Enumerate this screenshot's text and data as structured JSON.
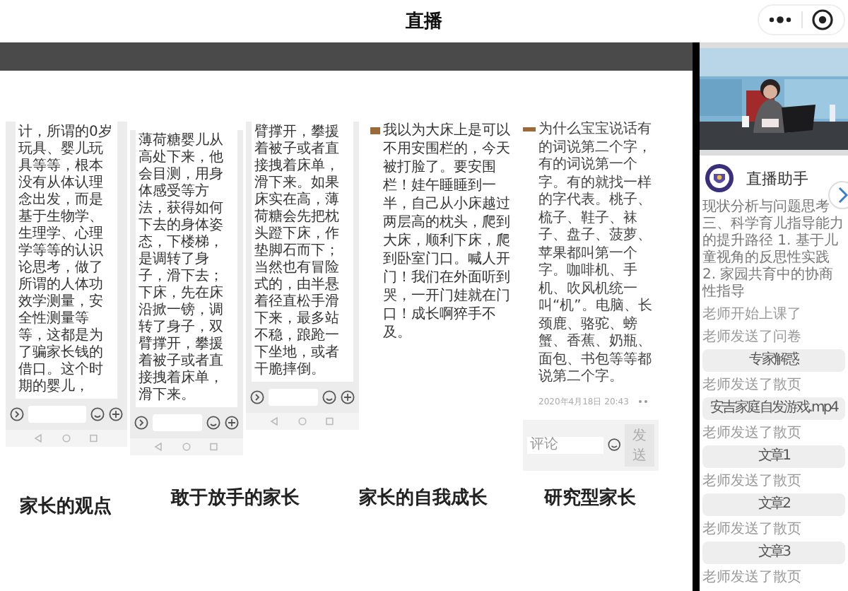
{
  "header": {
    "title": "直播"
  },
  "slide": {
    "screenshots": [
      {
        "kind": "chat",
        "text": "计，所谓的0岁玩具、婴儿玩具等等，根本没有从体认理念出发，而是基于生物学、生理学、心理学等等的认识论思考，做了所谓的人体功效学测量，安全性测量等等，这都是为了骗家长钱的借口。这个时期的婴儿，"
      },
      {
        "kind": "chat",
        "text": "薄荷糖婴儿从高处下来，他会目测，用身体感受等方法，获得如何下去的身体姿态，下楼梯，是调转了身子，滑下去；下床，先在床沿掀一镑，调转了身子，双臂撑开，攀援着被子或者直接拽着床单，滑下来。"
      },
      {
        "kind": "chat",
        "text": "臂撑开，攀援着被子或者直接拽着床单，滑下来。如果床实在高，薄荷糖会先把枕头蹬下床，作垫脚石而下；当然也有冒险式的，由半悬着径直松手滑下来，最多站不稳，踉跄一下坐地，或者干脆摔倒。"
      },
      {
        "kind": "post",
        "text": "我以为大床上是可以不用安围栏的，今天被打脸了。要安围栏！娃午睡睡到一半，自己从小床越过两层高的枕头，爬到大床，顺利下床，爬到卧室门口。喊人开门！我们在外面听到哭，一开门娃就在门口！成长啊猝手不及。"
      },
      {
        "kind": "comment",
        "text": "为什么宝宝说话有的词说第二个字，有的词说第一个字。有的就找一样的字代表。桃子、梳子、鞋子、袜子、盘子、菠萝、苹果都叫第一个字。咖啡机、手机、吹风机统一叫“机”。电脑、长颈鹿、骆驼、螃蟹、香蕉、奶瓶、面包、书包等等都说第二个字。",
        "time": "2020年4月18日 20:43",
        "placeholder": "评论",
        "send": "发送"
      }
    ],
    "captions": [
      "家长的观点",
      "敢于放手的家长",
      "家长的自我成长",
      "研究型家长"
    ]
  },
  "sidebar": {
    "assistant": "直播助手",
    "intro": "现状分析与问题思考三、科学育儿指导能力的提升路径 1. 基于儿童视角的反思性实践 2. 家园共育中的协商性指导",
    "messages": [
      {
        "kind": "notice",
        "text": "老师开始上课了"
      },
      {
        "kind": "notice",
        "text": "老师发送了问卷"
      },
      {
        "kind": "file",
        "text": "专家解惑"
      },
      {
        "kind": "notice",
        "text": "老师发送了散页"
      },
      {
        "kind": "file",
        "text": "安吉家庭自发游戏.mp4"
      },
      {
        "kind": "notice",
        "text": "老师发送了散页"
      },
      {
        "kind": "file",
        "text": "文章1"
      },
      {
        "kind": "notice",
        "text": "老师发送了散页"
      },
      {
        "kind": "file",
        "text": "文章2"
      },
      {
        "kind": "notice",
        "text": "老师发送了散页"
      },
      {
        "kind": "file",
        "text": "文章3"
      },
      {
        "kind": "notice",
        "text": "老师发送了散页"
      }
    ]
  }
}
